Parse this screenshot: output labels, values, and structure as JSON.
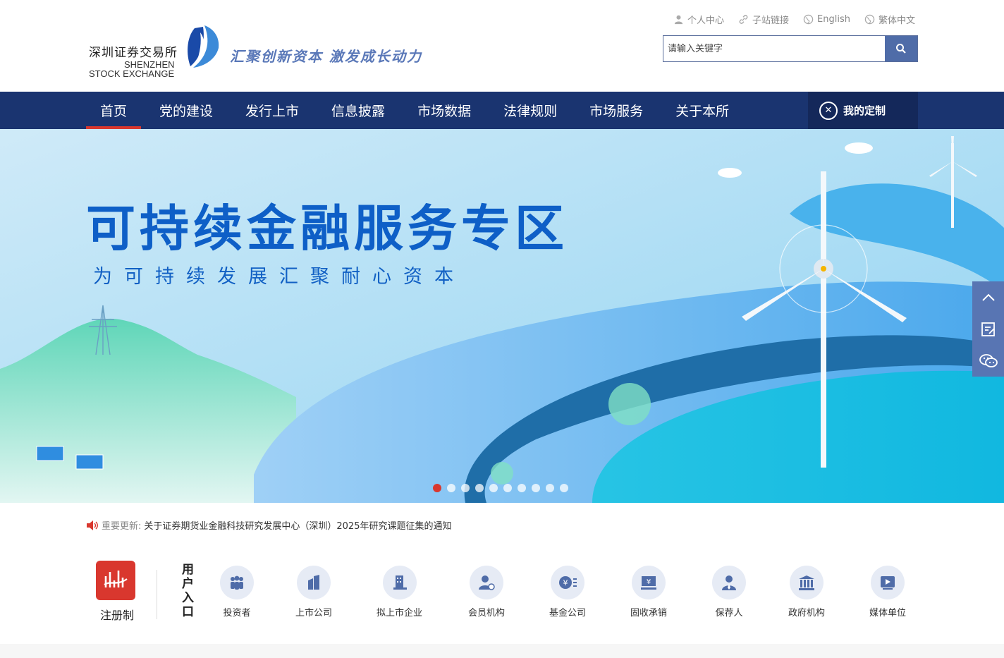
{
  "header": {
    "logo_cn": "深圳证券交易所",
    "logo_en_line1": "SHENZHEN",
    "logo_en_line2": "STOCK EXCHANGE",
    "slogan": "汇聚创新资本 激发成长动力",
    "links": [
      {
        "label": "个人中心",
        "icon": "user-icon"
      },
      {
        "label": "子站链接",
        "icon": "link-icon"
      },
      {
        "label": "English",
        "icon": "globe-icon"
      },
      {
        "label": "繁体中文",
        "icon": "globe-icon"
      }
    ],
    "search": {
      "placeholder": "请输入关键字",
      "icon": "search-icon"
    }
  },
  "nav": {
    "items": [
      "首页",
      "党的建设",
      "发行上市",
      "信息披露",
      "市场数据",
      "法律规则",
      "市场服务",
      "关于本所"
    ],
    "active": "首页",
    "custom_label": "我的定制"
  },
  "banner": {
    "title": "可持续金融服务专区",
    "subtitle": "为可持续发展汇聚耐心资本",
    "slides": 10,
    "active_slide": 1
  },
  "notice": {
    "label": "重要更新:",
    "text": "关于证券期货业金融科技研究发展中心（深圳）2025年研究课题征集的通知"
  },
  "entries": {
    "registration_label": "注册制",
    "user_entry_label": "用户入口",
    "items": [
      {
        "label": "投资者",
        "icon": "investors-icon"
      },
      {
        "label": "上市公司",
        "icon": "listed-company-icon"
      },
      {
        "label": "拟上市企业",
        "icon": "ipo-company-icon"
      },
      {
        "label": "会员机构",
        "icon": "member-icon"
      },
      {
        "label": "基金公司",
        "icon": "fund-icon"
      },
      {
        "label": "固收承销",
        "icon": "fixed-income-icon"
      },
      {
        "label": "保荐人",
        "icon": "sponsor-icon"
      },
      {
        "label": "政府机构",
        "icon": "government-icon"
      },
      {
        "label": "媒体单位",
        "icon": "media-icon"
      }
    ]
  },
  "colors": {
    "nav_bg": "#1a3470",
    "accent_red": "#d9372e",
    "brand_blue": "#4f6ca8"
  }
}
